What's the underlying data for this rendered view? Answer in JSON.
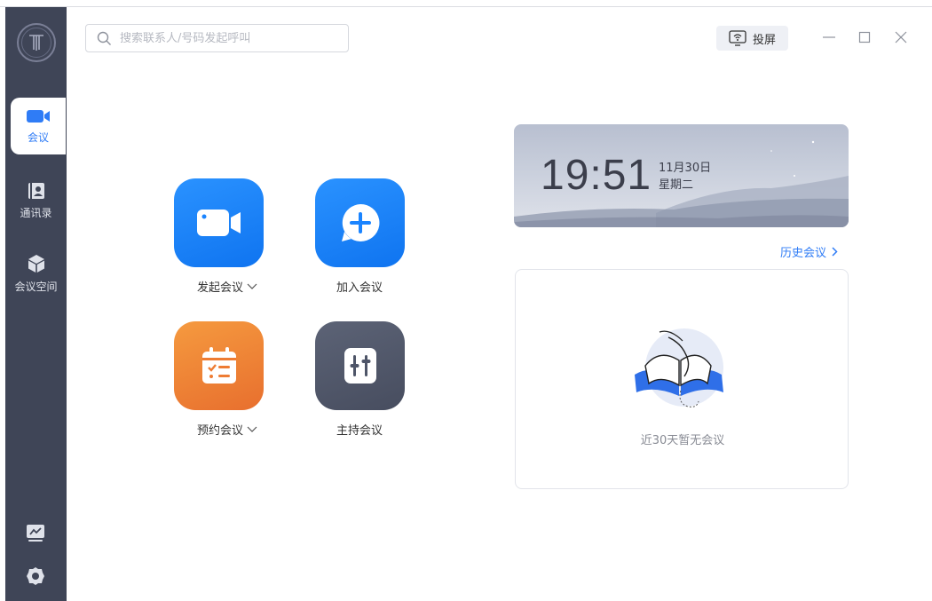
{
  "sidebar": {
    "logo_icon": "circle-t-logo",
    "items": [
      {
        "label": "会议",
        "icon": "video-camera-icon",
        "active": true
      },
      {
        "label": "通讯录",
        "icon": "contacts-icon",
        "active": false
      },
      {
        "label": "会议空间",
        "icon": "cube-icon",
        "active": false
      }
    ],
    "bottom_icons": [
      "whiteboard-icon",
      "settings-icon"
    ]
  },
  "search": {
    "placeholder": "搜索联系人/号码发起呼叫",
    "value": ""
  },
  "toolbar": {
    "cast_label": "投屏",
    "cast_icon": "screen-cast-icon"
  },
  "window_controls": [
    "minimize",
    "maximize",
    "close"
  ],
  "actions": [
    {
      "label": "发起会议",
      "icon": "video-camera-icon",
      "color": "#1a84ff",
      "has_dropdown": true
    },
    {
      "label": "加入会议",
      "icon": "plus-circle-icon",
      "color": "#1a84ff",
      "has_dropdown": false
    },
    {
      "label": "预约会议",
      "icon": "calendar-icon",
      "color": "#f0883a",
      "has_dropdown": true
    },
    {
      "label": "主持会议",
      "icon": "sliders-icon",
      "color": "#4e5568",
      "has_dropdown": false
    }
  ],
  "clock": {
    "time": "19:51",
    "date": "11月30日",
    "weekday": "星期二"
  },
  "history_link": "历史会议",
  "empty_state": {
    "text": "近30天暂无会议",
    "icon": "open-book-icon"
  },
  "colors": {
    "accent": "#2f7cf6",
    "sidebar_bg": "#3f4557"
  }
}
